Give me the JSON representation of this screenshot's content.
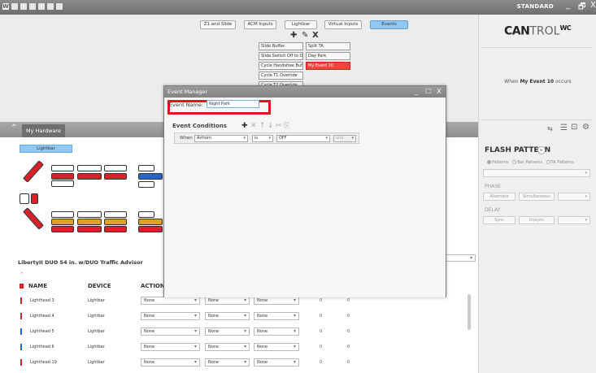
{
  "titlebar": {
    "logo": "W",
    "mode": "STANDARD",
    "minimize": "_",
    "restore": "🗗",
    "close": "X"
  },
  "tabs": [
    {
      "label": "Z1 and Slide"
    },
    {
      "label": "ACM Inputs"
    },
    {
      "label": "Lightbar"
    },
    {
      "label": "Virtual Inputs"
    },
    {
      "label": "Events",
      "active": true
    }
  ],
  "event_tools": {
    "add": "✚",
    "edit": "✎",
    "delete": "X"
  },
  "event_buttons": [
    {
      "label": "Slide Buffer"
    },
    {
      "label": "Split TA"
    },
    {
      "label": "Slide Switch Off to On"
    },
    {
      "label": "Day Park"
    },
    {
      "label": "Cycle Handsfree Buff..."
    },
    {
      "label": "My Event 10",
      "active": true
    },
    {
      "label": "Cycle T1 Override"
    },
    {
      "label": "Cycle T2 Override"
    }
  ],
  "brand": {
    "bold": "CAN",
    "light": "TROL",
    "sup": "WC"
  },
  "occurs": {
    "prefix": "When",
    "event": "My Event 10",
    "suffix": "occurs"
  },
  "hardware": {
    "tab_label": "My Hardware",
    "collapse_icon": "⌃",
    "lightbar_button": "Lightbar",
    "device_title": "LibertyII DUO 54 in. w/DUO Traffic Advisor"
  },
  "flash": {
    "title": "FLASH PATTERN",
    "radio": [
      "Patterns",
      "Bar Patterns",
      "TA Patterns"
    ],
    "phase_label": "PHASE",
    "phase_options": [
      "Alternate",
      "Simultaneous"
    ],
    "delay_label": "DELAY",
    "delay_options": [
      "Sync",
      "Unsync"
    ]
  },
  "table": {
    "headers": [
      "NAME",
      "DEVICE",
      "ACTION"
    ],
    "rows": [
      {
        "name": "Lighthead 3",
        "device": "Lightbar",
        "color": "#d8222a",
        "a1": "None",
        "a2": "None",
        "a3": "None",
        "n1": "0",
        "n2": "0"
      },
      {
        "name": "Lighthead 4",
        "device": "Lightbar",
        "color": "#d8222a",
        "a1": "None",
        "a2": "None",
        "a3": "None",
        "n1": "0",
        "n2": "0"
      },
      {
        "name": "Lighthead 5",
        "device": "Lightbar",
        "color": "#2266d0",
        "a1": "None",
        "a2": "None",
        "a3": "None",
        "n1": "0",
        "n2": "0"
      },
      {
        "name": "Lighthead 6",
        "device": "Lightbar",
        "color": "#2266d0",
        "a1": "None",
        "a2": "None",
        "a3": "None",
        "n1": "0",
        "n2": "0"
      },
      {
        "name": "Lighthead 19",
        "device": "Lightbar",
        "color": "#d8222a",
        "a1": "None",
        "a2": "None",
        "a3": "None",
        "n1": "0",
        "n2": "0"
      }
    ]
  },
  "dialog": {
    "title": "Event Manager",
    "minimize": "_",
    "maximize": "☐",
    "close": "X",
    "event_name_label": "Event Name:",
    "event_name_value": "Night Park",
    "conditions_label": "Event Conditions",
    "condition": {
      "when": "When",
      "input": "Airhorn",
      "op": "is",
      "state": "OFF",
      "join": "and"
    }
  },
  "colors": {
    "accent": "#8fc8f2",
    "highlight": "#e0141e",
    "active_event": "#e8473e"
  }
}
